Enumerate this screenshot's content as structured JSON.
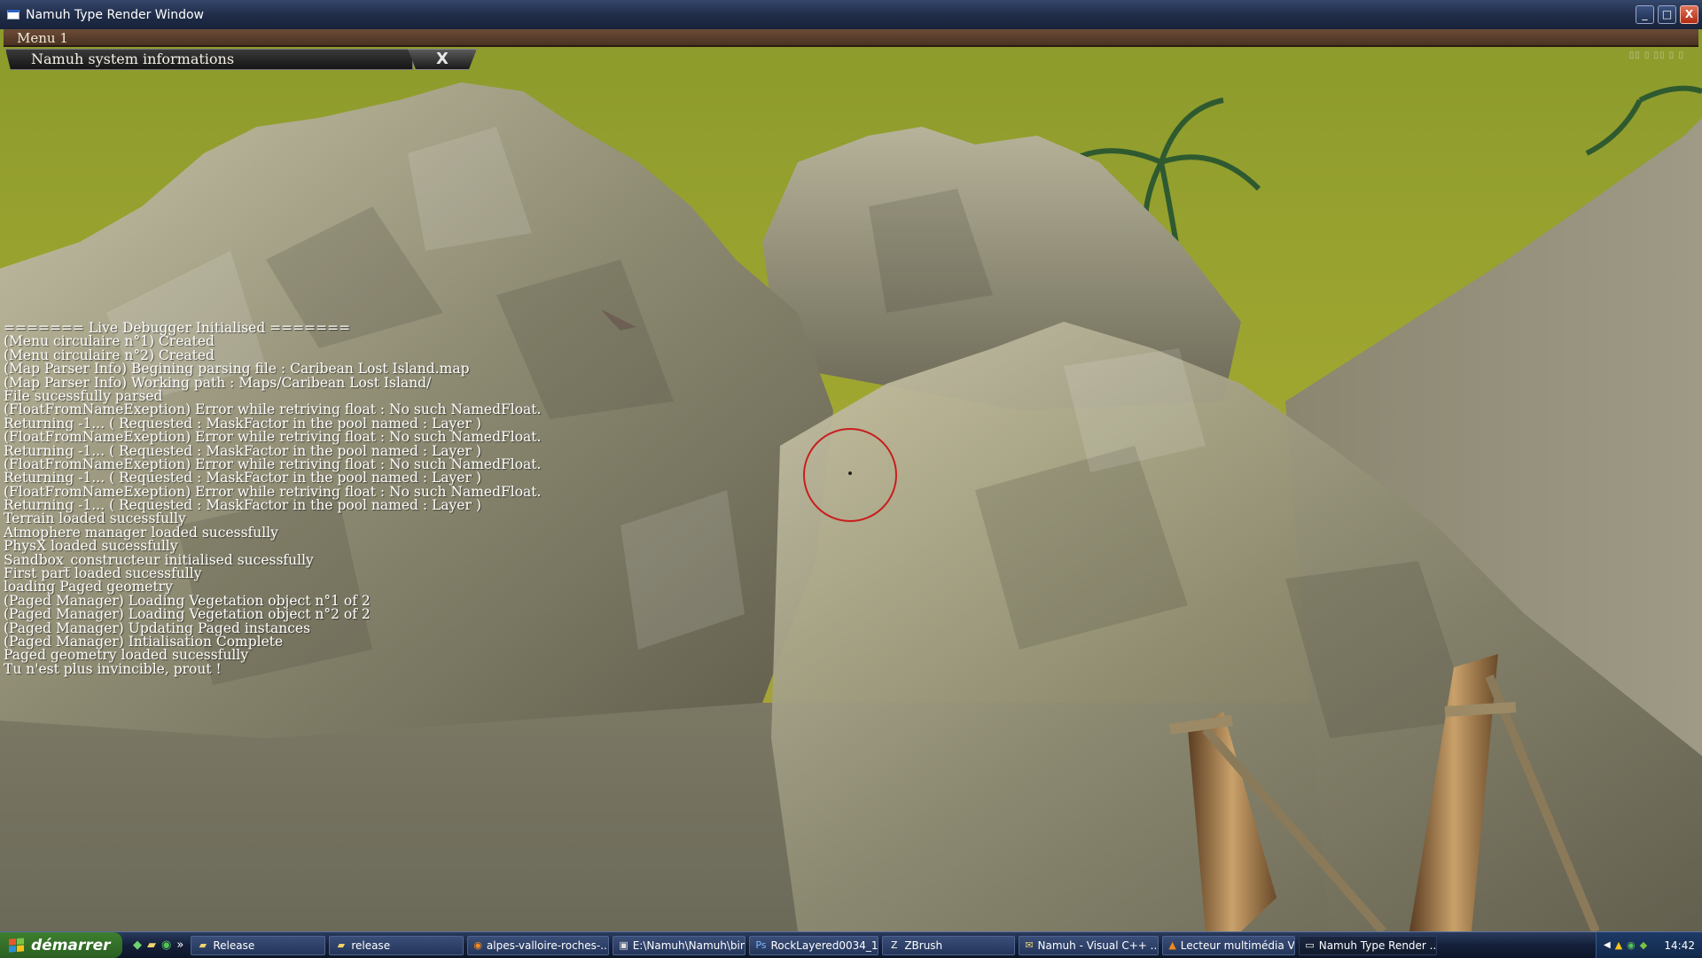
{
  "window": {
    "title": "Namuh Type Render Window",
    "controls": {
      "minimize": "_",
      "maximize": "□",
      "close": "X"
    }
  },
  "game_ui": {
    "menu_label": "Menu 1",
    "sysinfo_title": "Namuh system informations",
    "sysinfo_close": "X",
    "console_lines": [
      "======= Live Debugger Initialised =======",
      "(Menu circulaire n°1) Created",
      "(Menu circulaire n°2) Created",
      "(Map Parser Info) Begining parsing file : Caribean Lost Island.map",
      "(Map Parser Info) Working path : Maps/Caribean Lost Island/",
      "File sucessfully parsed",
      "(FloatFromNameExeption) Error while retriving float : No such NamedFloat.",
      "Returning -1... ( Requested : MaskFactor in the pool named : Layer )",
      "(FloatFromNameExeption) Error while retriving float : No such NamedFloat.",
      "Returning -1... ( Requested : MaskFactor in the pool named : Layer )",
      "(FloatFromNameExeption) Error while retriving float : No such NamedFloat.",
      "Returning -1... ( Requested : MaskFactor in the pool named : Layer )",
      "(FloatFromNameExeption) Error while retriving float : No such NamedFloat.",
      "Returning -1... ( Requested : MaskFactor in the pool named : Layer )",
      "Terrain loaded sucessfully",
      "Atmophere manager loaded sucessfully",
      "PhysX loaded sucessfully",
      "Sandbox_constructeur initialised sucessfully",
      "First part loaded sucessfully",
      "loading Paged geometry",
      "(Paged Manager) Loading Vegetation object n°1 of 2",
      "(Paged Manager) Loading Vegetation object n°2 of 2",
      "(Paged Manager) Updating Paged instances",
      "(Paged Manager) Intialisation Complete",
      "Paged geometry loaded sucessfully",
      "Tu n'est plus invincible, prout !"
    ]
  },
  "taskbar": {
    "start_label": "démarrer",
    "quicklaunch_overflow": "»",
    "tasks": [
      {
        "label": "Release",
        "icon": "folder-icon"
      },
      {
        "label": "release",
        "icon": "folder-icon"
      },
      {
        "label": "alpes-valloire-roches-...",
        "icon": "firefox-icon"
      },
      {
        "label": "E:\\Namuh\\Namuh\\bin...",
        "icon": "console-icon"
      },
      {
        "label": "RockLayered0034_1_...",
        "icon": "photoshop-icon"
      },
      {
        "label": "ZBrush",
        "icon": "zbrush-icon"
      },
      {
        "label": "Namuh - Visual C++ ...",
        "icon": "visual-studio-icon"
      },
      {
        "label": "Lecteur multimédia VLC",
        "icon": "vlc-icon"
      },
      {
        "label": "Namuh Type Render ...",
        "icon": "window-icon",
        "active": true
      }
    ],
    "clock": "14:42"
  },
  "colors": {
    "sky": "#9fa630",
    "rock_light": "#b9b49a",
    "rock_dark": "#5e5c4c",
    "crosshair": "#c81e1e",
    "menubar": "#5a3d2b"
  }
}
